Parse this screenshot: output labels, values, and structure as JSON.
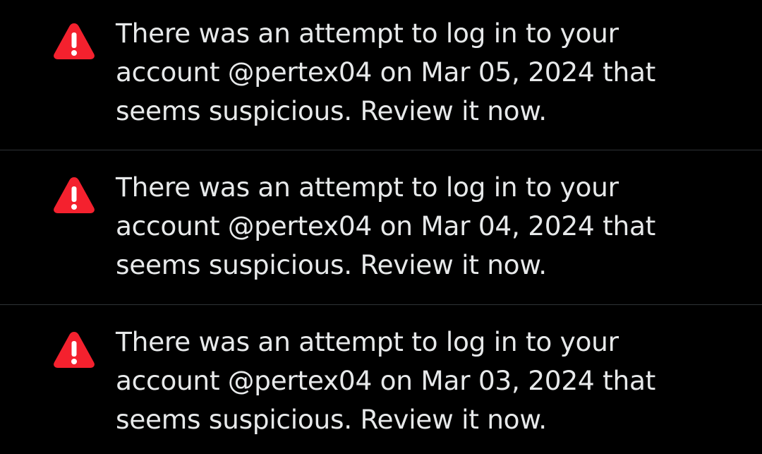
{
  "notifications": [
    {
      "icon": "warning-icon",
      "lines": [
        "There was an attempt to log in to your",
        "account @pertex04 on Mar 05, 2024 that",
        "seems suspicious. Review it now."
      ]
    },
    {
      "icon": "warning-icon",
      "lines": [
        "There was an attempt to log in to your",
        "account @pertex04 on Mar 04, 2024 that",
        "seems suspicious. Review it now."
      ]
    },
    {
      "icon": "warning-icon",
      "lines": [
        "There was an attempt to log in to your",
        "account @pertex04 on Mar 03, 2024 that",
        "seems suspicious. Review it now."
      ]
    }
  ],
  "colors": {
    "background": "#000000",
    "text": "#e7e9ea",
    "divider": "#2f3336",
    "warning": "#f4212e"
  }
}
